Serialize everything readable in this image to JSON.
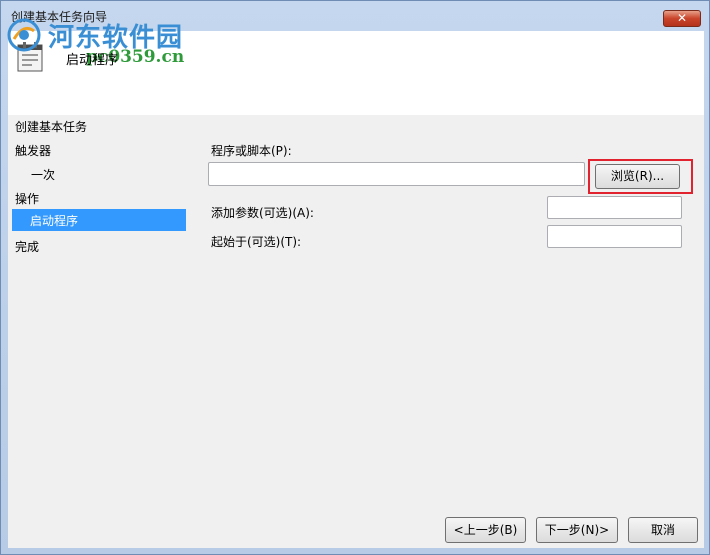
{
  "window": {
    "title": "创建基本任务向导",
    "close_label": "✕"
  },
  "header": {
    "title": "启动程序"
  },
  "watermark": {
    "main": "河东软件园",
    "url": "pc0359.cn"
  },
  "nav": {
    "heading": "创建基本任务",
    "items": [
      {
        "label": "触发器",
        "selected": false,
        "indent": false
      },
      {
        "label": "一次",
        "selected": false,
        "indent": true
      },
      {
        "label": "操作",
        "selected": false,
        "indent": false
      },
      {
        "label": "启动程序",
        "selected": true,
        "indent": true
      },
      {
        "label": "完成",
        "selected": false,
        "indent": false
      }
    ]
  },
  "form": {
    "program_label": "程序或脚本(P):",
    "program_value": "",
    "browse_label": "浏览(R)...",
    "args_label": "添加参数(可选)(A):",
    "args_value": "",
    "start_label": "起始于(可选)(T):",
    "start_value": ""
  },
  "footer": {
    "back_label": "<上一步(B)",
    "next_label": "下一步(N)>",
    "cancel_label": "取消"
  },
  "colors": {
    "selection": "#3399ff",
    "highlight_box": "#e0232f",
    "frame": "#b9cde8"
  }
}
